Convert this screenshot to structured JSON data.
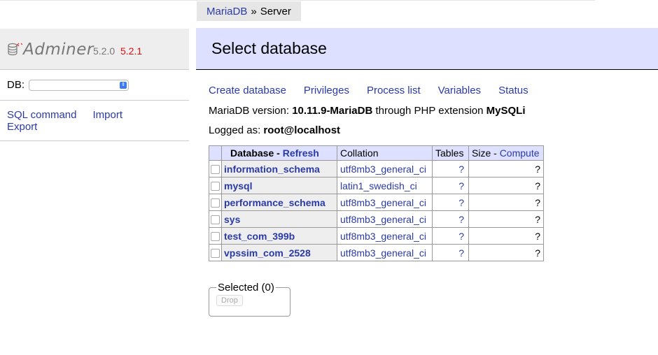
{
  "breadcrumb": {
    "server_link": "MariaDB",
    "separator": "»",
    "current": "Server"
  },
  "sidebar": {
    "app_name": "Adminer",
    "version": "5.2.0",
    "new_version": "5.2.1",
    "db_label": "DB:",
    "db_selected": "",
    "links": {
      "sql_command": "SQL command",
      "import": "Import",
      "export": "Export"
    }
  },
  "main": {
    "title": "Select database",
    "actions": [
      "Create database",
      "Privileges",
      "Process list",
      "Variables",
      "Status"
    ],
    "version_info": {
      "prefix": "MariaDB version:",
      "version": "10.11.9-MariaDB",
      "middle": "through PHP extension",
      "extension": "MySQLi"
    },
    "logged": {
      "prefix": "Logged as:",
      "user": "root@localhost"
    },
    "table": {
      "headers": {
        "database": "Database",
        "dash": " - ",
        "refresh": "Refresh",
        "collation": "Collation",
        "tables": "Tables",
        "size": "Size",
        "compute": "Compute"
      },
      "rows": [
        {
          "name": "information_schema",
          "collation": "utf8mb3_general_ci",
          "tables": "?",
          "size": "?"
        },
        {
          "name": "mysql",
          "collation": "latin1_swedish_ci",
          "tables": "?",
          "size": "?"
        },
        {
          "name": "performance_schema",
          "collation": "utf8mb3_general_ci",
          "tables": "?",
          "size": "?"
        },
        {
          "name": "sys",
          "collation": "utf8mb3_general_ci",
          "tables": "?",
          "size": "?"
        },
        {
          "name": "test_com_399b",
          "collation": "utf8mb3_general_ci",
          "tables": "?",
          "size": "?"
        },
        {
          "name": "vpssim_com_2528",
          "collation": "utf8mb3_general_ci",
          "tables": "?",
          "size": "?"
        }
      ]
    },
    "selected": {
      "legend": "Selected (0)",
      "drop": "Drop"
    }
  },
  "colors": {
    "link": "#2a3aa8",
    "header_bg": "#dde0fe",
    "new_version": "#dd1111"
  },
  "icons": [
    "database-icon",
    "dropdown-arrow-icon",
    "checkbox-icon"
  ]
}
